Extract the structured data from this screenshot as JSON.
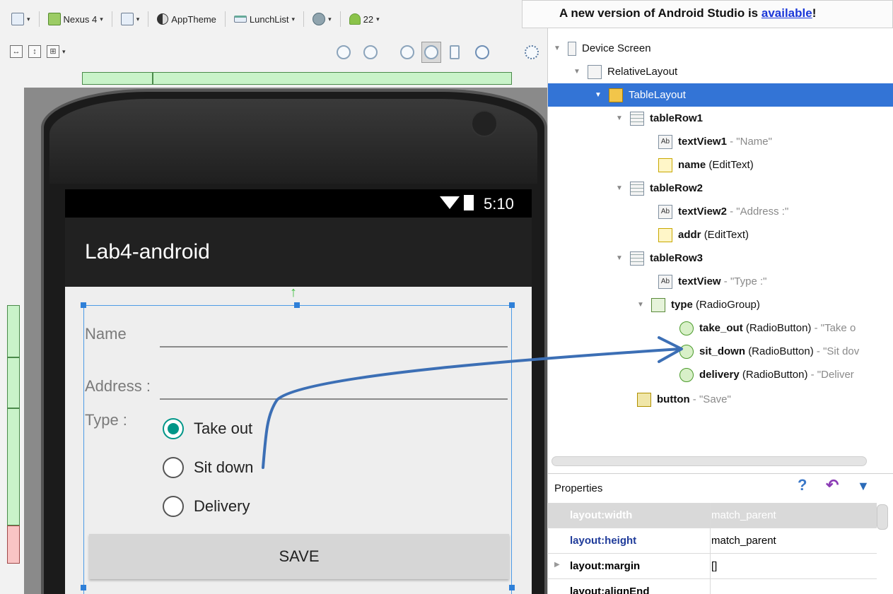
{
  "toolbar": {
    "device": "Nexus 4",
    "theme": "AppTheme",
    "activity": "LunchList",
    "api": "22"
  },
  "banner": {
    "text_prefix": "A new version of Android Studio is ",
    "link": "available",
    "text_suffix": "!"
  },
  "device": {
    "time": "5:10",
    "app_title": "Lab4-android"
  },
  "form": {
    "name_label": "Name",
    "address_label": "Address :",
    "type_label": "Type :",
    "options": [
      "Take out",
      "Sit down",
      "Delivery"
    ],
    "selected_option": "Take out",
    "save_label": "SAVE"
  },
  "tree": {
    "device_screen": "Device Screen",
    "relative_layout": "RelativeLayout",
    "table_layout": "TableLayout",
    "row1": "tableRow1",
    "tv1_name": "textView1",
    "tv1_value": "\"Name\"",
    "name_field": "name",
    "name_type": "(EditText)",
    "row2": "tableRow2",
    "tv2_name": "textView2",
    "tv2_value": "\"Address :\"",
    "addr_field": "addr",
    "addr_type": "(EditText)",
    "row3": "tableRow3",
    "tv_name": "textView",
    "tv_value": "\"Type :\"",
    "type_field": "type",
    "type_type": "(RadioGroup)",
    "rb1_name": "take_out",
    "rb1_type": "(RadioButton)",
    "rb1_value": "\"Take o",
    "rb2_name": "sit_down",
    "rb2_type": "(RadioButton)",
    "rb2_value": "\"Sit dov",
    "rb3_name": "delivery",
    "rb3_type": "(RadioButton)",
    "rb3_value": "\"Deliver",
    "button_name": "button",
    "button_value": "\"Save\""
  },
  "properties": {
    "title": "Properties",
    "rows": [
      {
        "name": "layout:width",
        "value": "match_parent"
      },
      {
        "name": "layout:height",
        "value": "match_parent"
      },
      {
        "name": "layout:margin",
        "value": "[]"
      },
      {
        "name": "layout:alignEnd",
        "value": ""
      }
    ]
  },
  "colors": {
    "selection": "#3374d6",
    "accent_radio": "#009688",
    "annotation_arrow": "#3c6fb5"
  },
  "icons": {
    "help": "?",
    "undo": "↶",
    "filter": "▼"
  }
}
